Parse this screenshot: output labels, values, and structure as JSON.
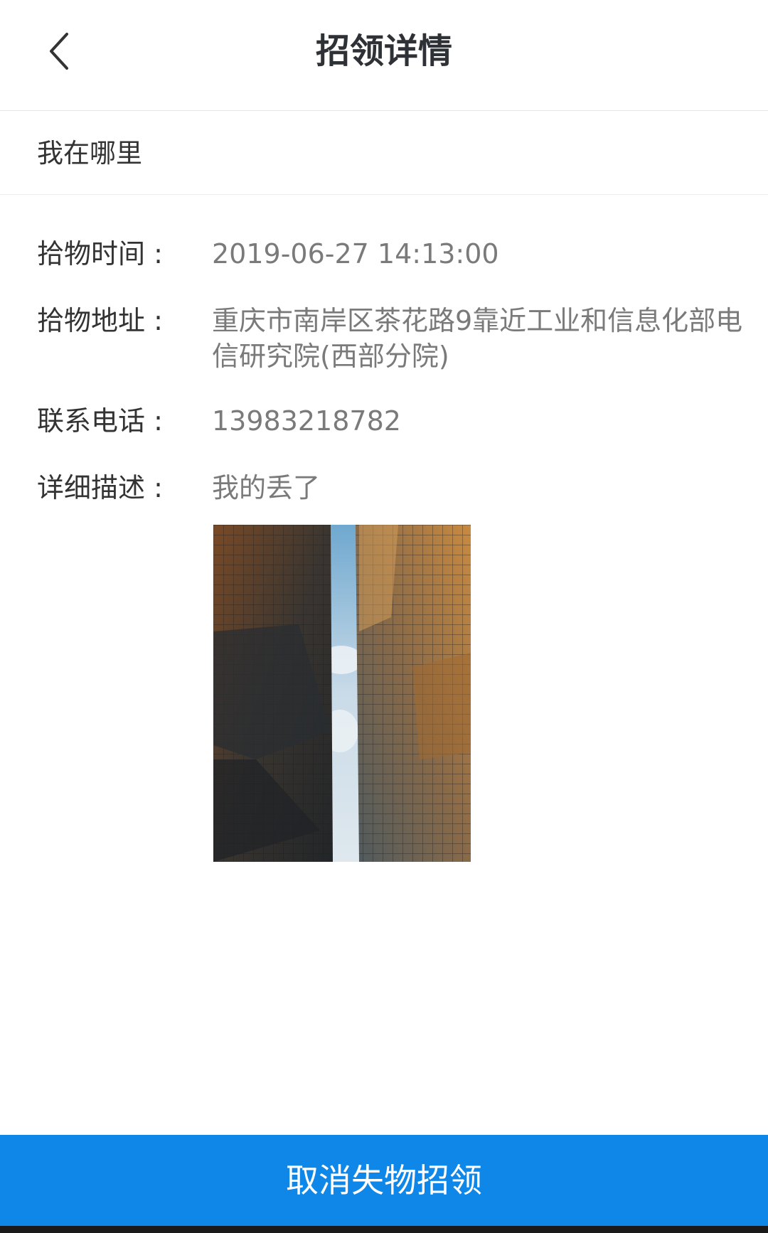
{
  "header": {
    "title": "招领详情",
    "back_icon": "chevron-left-icon"
  },
  "section": {
    "title": "我在哪里"
  },
  "details": {
    "time_label": "拾物时间 :",
    "time_value": "2019-06-27 14:13:00",
    "address_label": "拾物地址 :",
    "address_value": "重庆市南岸区茶花路9靠近工业和信息化部电信研究院(西部分院)",
    "phone_label": "联系电话 :",
    "phone_value": "13983218782",
    "desc_label": "详细描述 :",
    "desc_value": "我的丢了"
  },
  "action": {
    "cancel_label": "取消失物招领"
  },
  "colors": {
    "primary": "#0f87e8",
    "label_text": "#333333",
    "value_text": "#7a7a7a",
    "divider": "#eeeeee"
  }
}
